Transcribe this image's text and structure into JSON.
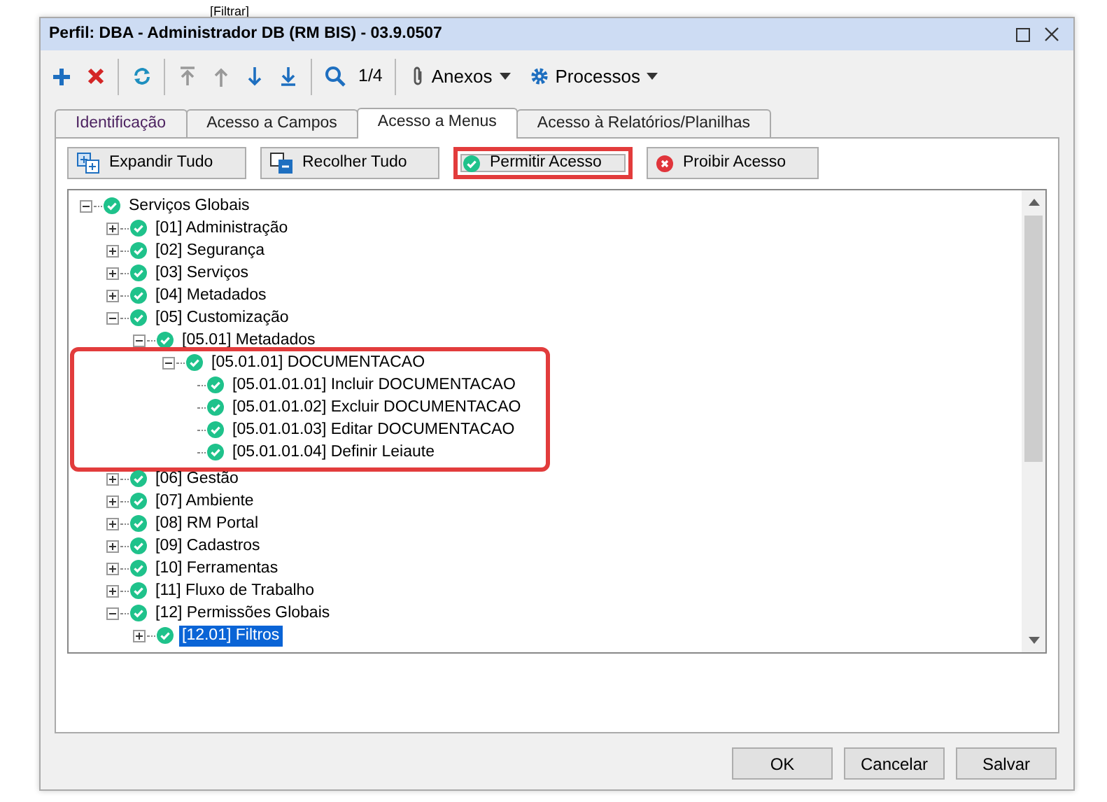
{
  "background": {
    "filter_text": "[Filtrar]"
  },
  "window": {
    "title": "Perfil: DBA - Administrador DB (RM BIS) - 03.9.0507"
  },
  "toolbar": {
    "page_indicator": "1/4",
    "menus": [
      {
        "label": "Anexos",
        "kind": "clip"
      },
      {
        "label": "Processos",
        "kind": "gear"
      }
    ]
  },
  "tabs": [
    {
      "label": "Identificação",
      "selected": false
    },
    {
      "label": "Acesso a Campos",
      "selected": false
    },
    {
      "label": "Acesso a Menus",
      "selected": true
    },
    {
      "label": "Acesso à Relatórios/Planilhas",
      "selected": false
    }
  ],
  "actions": [
    {
      "label": "Expandir Tudo",
      "kind": "expand",
      "highlighted": false
    },
    {
      "label": "Recolher Tudo",
      "kind": "collapse",
      "highlighted": false
    },
    {
      "label": "Permitir Acesso",
      "kind": "allow",
      "highlighted": true
    },
    {
      "label": "Proibir Acesso",
      "kind": "deny",
      "highlighted": false
    }
  ],
  "tree": [
    {
      "label": "Serviços Globais",
      "allowed": true,
      "expanded": true,
      "selected": false,
      "highlighted": false,
      "children": [
        {
          "label": "[01] Administração",
          "allowed": true,
          "expanded": false,
          "selected": false,
          "highlighted": false
        },
        {
          "label": "[02] Segurança",
          "allowed": true,
          "expanded": false,
          "selected": false,
          "highlighted": false
        },
        {
          "label": "[03] Serviços",
          "allowed": true,
          "expanded": false,
          "selected": false,
          "highlighted": false
        },
        {
          "label": "[04] Metadados",
          "allowed": true,
          "expanded": false,
          "selected": false,
          "highlighted": false
        },
        {
          "label": "[05] Customização",
          "allowed": true,
          "expanded": true,
          "selected": false,
          "highlighted": false,
          "children": [
            {
              "label": "[05.01] Metadados",
              "allowed": true,
              "expanded": true,
              "selected": false,
              "highlighted": false,
              "children": [
                {
                  "label": "[05.01.01] DOCUMENTACAO",
                  "allowed": true,
                  "expanded": true,
                  "selected": false,
                  "highlighted": true,
                  "children": [
                    {
                      "label": "[05.01.01.01] Incluir DOCUMENTACAO",
                      "allowed": true,
                      "selected": false,
                      "highlighted": false
                    },
                    {
                      "label": "[05.01.01.02] Excluir DOCUMENTACAO",
                      "allowed": true,
                      "selected": false,
                      "highlighted": false
                    },
                    {
                      "label": "[05.01.01.03] Editar DOCUMENTACAO",
                      "allowed": true,
                      "selected": false,
                      "highlighted": false
                    },
                    {
                      "label": "[05.01.01.04] Definir Leiaute",
                      "allowed": true,
                      "selected": false,
                      "highlighted": false
                    }
                  ]
                }
              ]
            }
          ]
        },
        {
          "label": "[06] Gestão",
          "allowed": true,
          "expanded": false,
          "selected": false,
          "highlighted": false
        },
        {
          "label": "[07] Ambiente",
          "allowed": true,
          "expanded": false,
          "selected": false,
          "highlighted": false
        },
        {
          "label": "[08] RM Portal",
          "allowed": true,
          "expanded": false,
          "selected": false,
          "highlighted": false
        },
        {
          "label": "[09] Cadastros",
          "allowed": true,
          "expanded": false,
          "selected": false,
          "highlighted": false
        },
        {
          "label": "[10] Ferramentas",
          "allowed": true,
          "expanded": false,
          "selected": false,
          "highlighted": false
        },
        {
          "label": "[11] Fluxo de Trabalho",
          "allowed": true,
          "expanded": false,
          "selected": false,
          "highlighted": false
        },
        {
          "label": "[12] Permissões Globais",
          "allowed": true,
          "expanded": true,
          "selected": false,
          "highlighted": false,
          "children": [
            {
              "label": "[12.01] Filtros",
              "allowed": true,
              "expanded": false,
              "selected": true,
              "highlighted": false
            }
          ]
        }
      ]
    }
  ],
  "footer_buttons": [
    "OK",
    "Cancelar",
    "Salvar"
  ]
}
